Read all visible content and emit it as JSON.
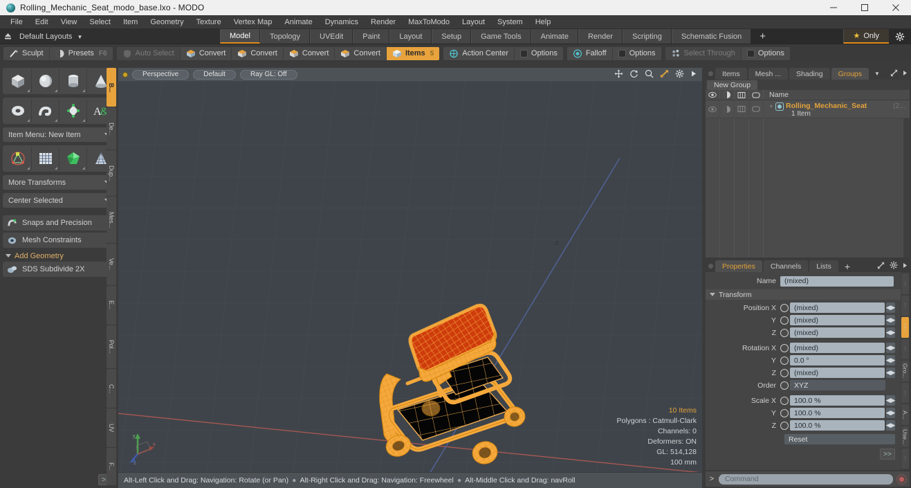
{
  "window": {
    "title": "Rolling_Mechanic_Seat_modo_base.lxo - MODO",
    "app_icon": "modo-logo-icon",
    "minimize": "minimize-icon",
    "maximize": "maximize-icon",
    "close": "close-icon"
  },
  "menubar": {
    "items": [
      "File",
      "Edit",
      "View",
      "Select",
      "Item",
      "Geometry",
      "Texture",
      "Vertex Map",
      "Animate",
      "Dynamics",
      "Render",
      "MaxToModo",
      "Layout",
      "System",
      "Help"
    ]
  },
  "layoutbar": {
    "layouts_label": "Default Layouts",
    "tabs": [
      {
        "label": "Model",
        "active": true
      },
      {
        "label": "Topology",
        "active": false
      },
      {
        "label": "UVEdit",
        "active": false
      },
      {
        "label": "Paint",
        "active": false
      },
      {
        "label": "Layout",
        "active": false
      },
      {
        "label": "Setup",
        "active": false
      },
      {
        "label": "Game Tools",
        "active": false
      },
      {
        "label": "Animate",
        "active": false
      },
      {
        "label": "Render",
        "active": false
      },
      {
        "label": "Scripting",
        "active": false
      },
      {
        "label": "Schematic Fusion",
        "active": false
      }
    ],
    "add_tab": "+",
    "only_label": "Only",
    "star_icon": "star-icon",
    "gear_icon": "gear-icon"
  },
  "toolbar": {
    "groups": [
      {
        "buttons": [
          {
            "label": "Sculpt",
            "icon": "brush-icon",
            "state": "normal",
            "hint": ""
          },
          {
            "label": "Presets",
            "icon": "sphere-icon",
            "state": "normal",
            "hint": "F6"
          }
        ]
      },
      {
        "buttons": [
          {
            "label": "Auto Select",
            "icon": "shield-icon",
            "state": "dim",
            "hint": ""
          },
          {
            "label": "Convert",
            "icon": "cube-icon",
            "state": "normal",
            "hint": ""
          },
          {
            "label": "Convert",
            "icon": "cube-icon",
            "state": "normal",
            "hint": ""
          },
          {
            "label": "Convert",
            "icon": "cube-icon",
            "state": "normal",
            "hint": ""
          },
          {
            "label": "Convert",
            "icon": "cube-icon",
            "state": "normal",
            "hint": ""
          },
          {
            "label": "Items",
            "icon": "cube-icon",
            "state": "highlight",
            "hint": "5"
          }
        ]
      },
      {
        "buttons": [
          {
            "label": "Action Center",
            "icon": "target-icon",
            "state": "normal",
            "hint": ""
          },
          {
            "label": "Options",
            "icon": "checkbox-icon",
            "state": "normal",
            "hint": ""
          }
        ]
      },
      {
        "buttons": [
          {
            "label": "Falloff",
            "icon": "falloff-icon",
            "state": "normal",
            "hint": ""
          },
          {
            "label": "Options",
            "icon": "checkbox-icon",
            "state": "normal",
            "hint": ""
          }
        ]
      },
      {
        "buttons": [
          {
            "label": "Select Through",
            "icon": "select-through-icon",
            "state": "dim",
            "hint": ""
          },
          {
            "label": "Options",
            "icon": "checkbox-icon",
            "state": "normal",
            "hint": ""
          }
        ]
      }
    ]
  },
  "left_panel": {
    "primitive_row_1": [
      {
        "icon": "cube-primitive-icon"
      },
      {
        "icon": "sphere-primitive-icon"
      },
      {
        "icon": "cylinder-primitive-icon"
      },
      {
        "icon": "cone-primitive-icon"
      }
    ],
    "primitive_row_2": [
      {
        "icon": "torus-primitive-icon"
      },
      {
        "icon": "spiral-primitive-icon"
      },
      {
        "icon": "teapot-primitive-icon"
      },
      {
        "icon": "text-primitive-icon"
      }
    ],
    "item_menu": "Item Menu: New Item",
    "tool_row": [
      {
        "icon": "transform-icon"
      },
      {
        "icon": "grid-icon"
      },
      {
        "icon": "gem-icon"
      },
      {
        "icon": "mesh-cone-icon"
      }
    ],
    "more_transforms": "More Transforms",
    "center_selected": "Center Selected",
    "snaps": "Snaps and Precision",
    "snaps_icon": "magnet-icon",
    "mesh_constraints": "Mesh Constraints",
    "mesh_constraints_icon": "constraint-icon",
    "add_geometry": "Add Geometry",
    "sds_subdivide": "SDS Subdivide 2X",
    "sds_icon": "subdivide-icon",
    "expand_button": ">>",
    "vertical_tabs": [
      {
        "label": "B...",
        "active": true
      },
      {
        "label": "De...",
        "active": false
      },
      {
        "label": "Dup...",
        "active": false
      },
      {
        "label": "Mes...",
        "active": false
      },
      {
        "label": "Ve...",
        "active": false
      },
      {
        "label": "E...",
        "active": false
      },
      {
        "label": "Pol...",
        "active": false
      },
      {
        "label": "C...",
        "active": false
      },
      {
        "label": "UV",
        "active": false
      },
      {
        "label": "F...",
        "active": false
      }
    ]
  },
  "viewport": {
    "header": {
      "dot": "viewport-active-dot",
      "view_mode": "Perspective",
      "shading": "Default",
      "raygl": "Ray GL: Off",
      "nav_icons": [
        "pan-icon",
        "rotate-icon",
        "zoom-icon",
        "fit-icon",
        "gear-icon",
        "more-icon"
      ]
    },
    "axis_label": "-z",
    "stats": {
      "items": "10 Items",
      "polygons": "Polygons : Catmull-Clark",
      "channels": "Channels: 0",
      "deformers": "Deformers: ON",
      "gl": "GL: 514,128",
      "scale": "100 mm"
    },
    "gizmo": {
      "x": "x",
      "y": "y",
      "z": "z"
    },
    "model_name": "rolling-mechanic-seat-wireframe"
  },
  "status_bar": {
    "hints": [
      "Alt-Left Click and Drag: Navigation: Rotate (or Pan)",
      "Alt-Right Click and Drag: Navigation: Freewheel",
      "Alt-Middle Click and Drag: navRoll"
    ],
    "separator": "●"
  },
  "right_panel": {
    "top_tabs": [
      {
        "label": "Items",
        "active": false
      },
      {
        "label": "Mesh ...",
        "active": false
      },
      {
        "label": "Shading",
        "active": false
      },
      {
        "label": "Groups",
        "active": true
      }
    ],
    "top_tab_caret": "chevron-down-icon",
    "expand_icon": "expand-icon",
    "more_icon": "more-icon",
    "new_group_button": "New Group",
    "tree": {
      "columns": [
        "eye-icon",
        "shade-icon",
        "wire-icon",
        "select-icon"
      ],
      "name_header": "Name",
      "rows": [
        {
          "name": "Rolling_Mechanic_Seat",
          "count": "(2...",
          "sub": "1 Item",
          "icon": "group-icon",
          "expander": "+"
        }
      ]
    },
    "props_tabs": [
      {
        "label": "Properties",
        "active": true
      },
      {
        "label": "Channels",
        "active": false
      },
      {
        "label": "Lists",
        "active": false
      },
      {
        "label": "+",
        "active": false
      }
    ],
    "properties": {
      "name_label": "Name",
      "name_value": "(mixed)",
      "transform_section": "Transform",
      "fields": [
        {
          "label": "Position X",
          "value": "(mixed)",
          "type": "num"
        },
        {
          "label": "Y",
          "value": "(mixed)",
          "type": "num"
        },
        {
          "label": "Z",
          "value": "(mixed)",
          "type": "num"
        },
        {
          "label": "Rotation X",
          "value": "(mixed)",
          "type": "num"
        },
        {
          "label": "Y",
          "value": "0.0 °",
          "type": "num"
        },
        {
          "label": "Z",
          "value": "(mixed)",
          "type": "num"
        },
        {
          "label": "Order",
          "value": "XYZ",
          "type": "dropdown"
        },
        {
          "label": "Scale X",
          "value": "100.0 %",
          "type": "num"
        },
        {
          "label": "Y",
          "value": "100.0 %",
          "type": "num"
        },
        {
          "label": "Z",
          "value": "100.0 %",
          "type": "num"
        }
      ],
      "reset_label": "Reset",
      "expand_button": ">>"
    },
    "side_tabs": [
      {
        "label": "",
        "active": false
      },
      {
        "label": "",
        "active": false
      },
      {
        "label": "",
        "active": true
      },
      {
        "label": "",
        "active": false
      },
      {
        "label": "Gro...",
        "active": false
      },
      {
        "label": "",
        "active": false
      },
      {
        "label": "A...",
        "active": false
      },
      {
        "label": "Use...",
        "active": false
      },
      {
        "label": "",
        "active": false
      }
    ],
    "command_bar": {
      "prompt": ">",
      "placeholder": "Command",
      "record_icon": "record-icon"
    }
  },
  "colors": {
    "accent_orange": "#e8a33d",
    "selection_orange": "#f0a93c",
    "selection_red": "#d64410",
    "panel_bg": "#3b3b3b",
    "viewport_bg": "#3f444a",
    "field_blue": "#a9b4bd"
  }
}
